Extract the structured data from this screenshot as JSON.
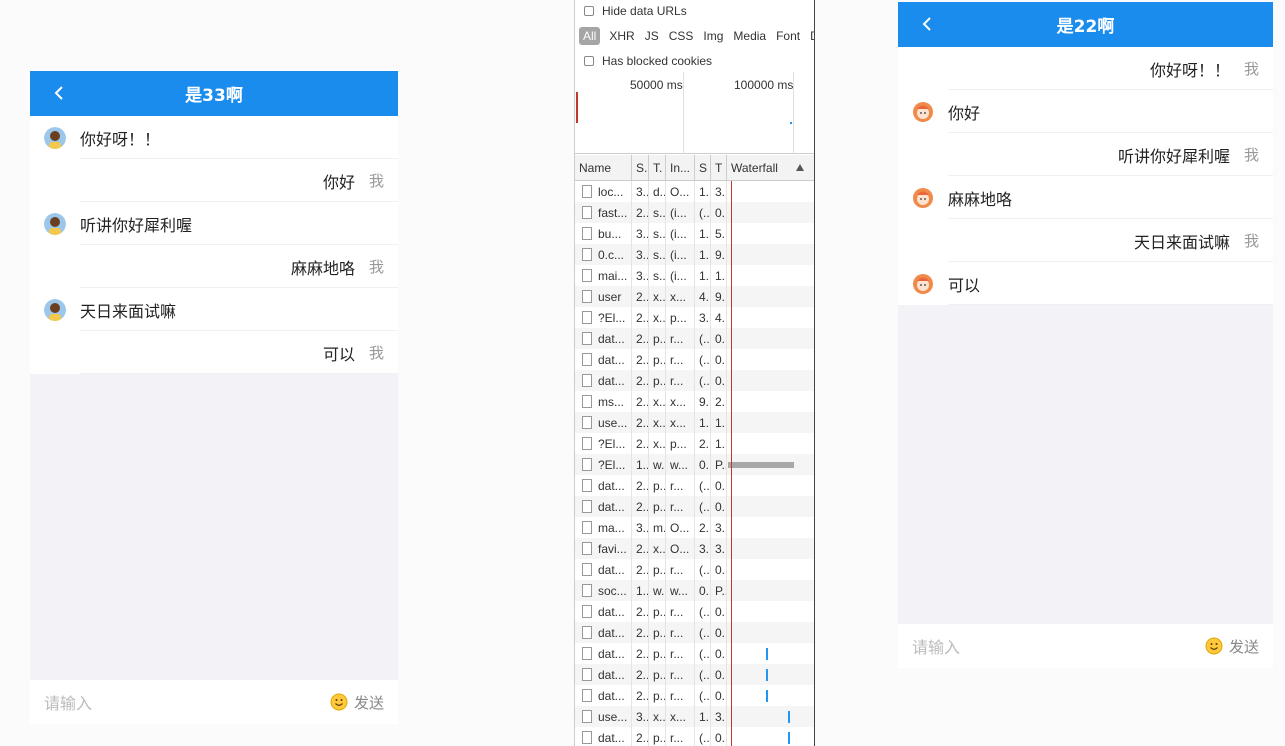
{
  "left_chat": {
    "title": "是33啊",
    "messages": [
      {
        "side": "left",
        "text": "你好呀！！"
      },
      {
        "side": "right",
        "text": "你好",
        "me": "我"
      },
      {
        "side": "left",
        "text": "听讲你好犀利喔"
      },
      {
        "side": "right",
        "text": "麻麻地咯",
        "me": "我"
      },
      {
        "side": "left",
        "text": "天日来面试嘛"
      },
      {
        "side": "right",
        "text": "可以",
        "me": "我"
      }
    ],
    "input_placeholder": "请输入",
    "send_label": "发送"
  },
  "right_chat": {
    "title": "是22啊",
    "messages": [
      {
        "side": "right",
        "text": "你好呀！！",
        "me": "我"
      },
      {
        "side": "left",
        "text": "你好"
      },
      {
        "side": "right",
        "text": "听讲你好犀利喔",
        "me": "我"
      },
      {
        "side": "left",
        "text": "麻麻地咯"
      },
      {
        "side": "right",
        "text": "天日来面试嘛",
        "me": "我"
      },
      {
        "side": "left",
        "text": "可以"
      }
    ],
    "input_placeholder": "请输入",
    "send_label": "发送"
  },
  "devtools": {
    "hide_data_urls": "Hide data URLs",
    "filters": [
      "All",
      "XHR",
      "JS",
      "CSS",
      "Img",
      "Media",
      "Font",
      "Do"
    ],
    "has_blocked_cookies": "Has blocked cookies",
    "timeline_labels": [
      "50000 ms",
      "100000 ms"
    ],
    "columns": [
      "Name",
      "S.",
      "T.",
      "In...",
      "S",
      "T",
      "Waterfall"
    ],
    "rows": [
      [
        "loc...",
        "3..",
        "d..",
        "O...",
        "1..",
        "3.."
      ],
      [
        "fast...",
        "2..",
        "s..",
        "(i...",
        "(...",
        "0.."
      ],
      [
        "bu...",
        "3..",
        "s..",
        "(i...",
        "1..",
        "5.."
      ],
      [
        "0.c...",
        "3..",
        "s..",
        "(i...",
        "1..",
        "9.."
      ],
      [
        "mai...",
        "3..",
        "s..",
        "(i...",
        "1..",
        "1.."
      ],
      [
        "user",
        "2..",
        "x..",
        "x...",
        "4..",
        "9.."
      ],
      [
        "?El...",
        "2..",
        "x..",
        "p...",
        "3..",
        "4.."
      ],
      [
        "dat...",
        "2..",
        "p..",
        "r...",
        "(...",
        "0.."
      ],
      [
        "dat...",
        "2..",
        "p..",
        "r...",
        "(...",
        "0.."
      ],
      [
        "dat...",
        "2..",
        "p..",
        "r...",
        "(...",
        "0.."
      ],
      [
        "ms...",
        "2..",
        "x..",
        "x...",
        "9..",
        "2.."
      ],
      [
        "use...",
        "2..",
        "x..",
        "x...",
        "1..",
        "1.."
      ],
      [
        "?El...",
        "2..",
        "x..",
        "p...",
        "2..",
        "1.."
      ],
      [
        "?El...",
        "1..",
        "w..",
        "w...",
        "0..",
        "P.."
      ],
      [
        "dat...",
        "2..",
        "p..",
        "r...",
        "(...",
        "0.."
      ],
      [
        "dat...",
        "2..",
        "p..",
        "r...",
        "(...",
        "0.."
      ],
      [
        "ma...",
        "3..",
        "m..",
        "O...",
        "2..",
        "3.."
      ],
      [
        "favi...",
        "2..",
        "x..",
        "O...",
        "3..",
        "3.."
      ],
      [
        "dat...",
        "2..",
        "p..",
        "r...",
        "(...",
        "0.."
      ],
      [
        "soc...",
        "1..",
        "w..",
        "w...",
        "0..",
        "P.."
      ],
      [
        "dat...",
        "2..",
        "p..",
        "r...",
        "(...",
        "0.."
      ],
      [
        "dat...",
        "2..",
        "p..",
        "r...",
        "(...",
        "0.."
      ],
      [
        "dat...",
        "2..",
        "p..",
        "r...",
        "(...",
        "0.."
      ],
      [
        "dat...",
        "2..",
        "p..",
        "r...",
        "(...",
        "0.."
      ],
      [
        "dat...",
        "2..",
        "p..",
        "r...",
        "(...",
        "0.."
      ],
      [
        "use...",
        "3..",
        "x..",
        "x...",
        "1..",
        "3.."
      ],
      [
        "dat...",
        "2..",
        "p..",
        "r...",
        "(...",
        "0.."
      ]
    ]
  },
  "colors": {
    "header_blue": "#1a8cee",
    "waterfall_blue": "#2196f3"
  }
}
